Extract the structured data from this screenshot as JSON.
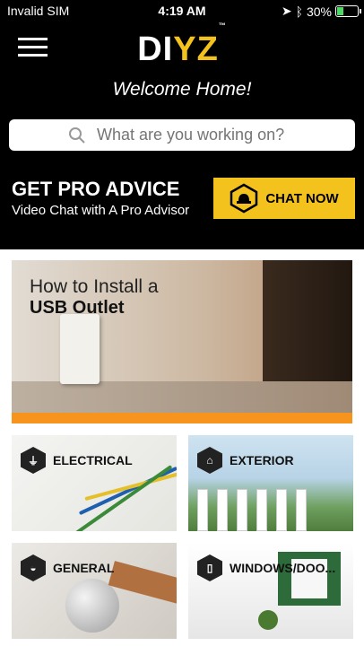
{
  "status_bar": {
    "carrier": "Invalid SIM",
    "time": "4:19 AM",
    "battery": "30%",
    "battery_level": 0.3
  },
  "header": {
    "logo_prefix": "DI",
    "logo_suffix": "YZ",
    "logo_tm": "™",
    "welcome": "Welcome Home!"
  },
  "search": {
    "placeholder": "What are you working on?"
  },
  "pro_advice": {
    "title": "GET PRO ADVICE",
    "subtitle": "Video Chat with A Pro Advisor",
    "button_label": "CHAT NOW"
  },
  "featured": {
    "line1": "How to Install a",
    "line2": "USB Outlet",
    "accent_color": "#f7941d"
  },
  "categories": [
    {
      "label": "ELECTRICAL",
      "icon": "plug-icon"
    },
    {
      "label": "EXTERIOR",
      "icon": "house-icon"
    },
    {
      "label": "GENERAL",
      "icon": "helmet-icon"
    },
    {
      "label": "WINDOWS/DOO...",
      "icon": "door-icon"
    }
  ],
  "colors": {
    "brand_yellow": "#f4c21c",
    "background": "#000000"
  }
}
